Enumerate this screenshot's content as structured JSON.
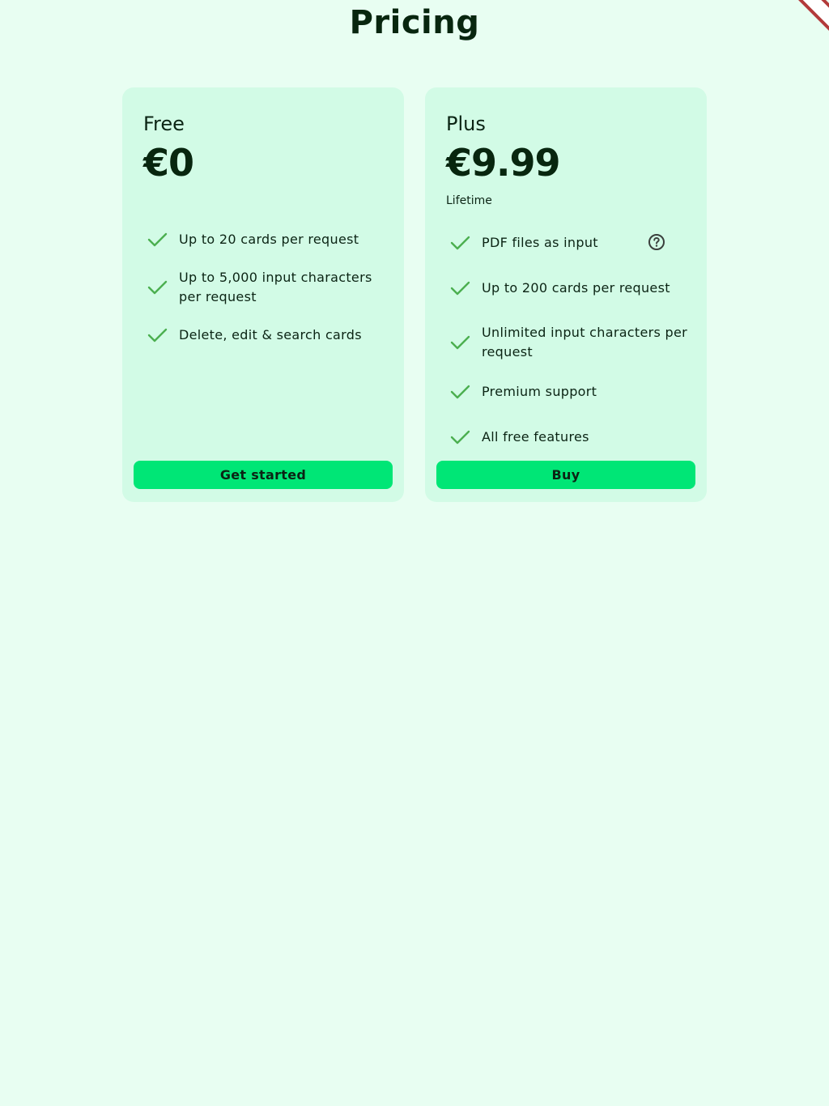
{
  "page": {
    "title": "Pricing"
  },
  "colors": {
    "background": "#e8fef2",
    "card": "#d2fbe6",
    "accent": "#00e676",
    "check": "#4caf50",
    "ribbon": "#b23a3a"
  },
  "plans": [
    {
      "name": "Free",
      "price": "€0",
      "period": "",
      "features": [
        "Up to 20 cards per request",
        "Up to 5,000 input characters per request",
        "Delete, edit & search cards"
      ],
      "cta_label": "Get started"
    },
    {
      "name": "Plus",
      "price": "€9.99",
      "period": "Lifetime",
      "features": [
        "PDF files as input",
        "Up to 200 cards per request",
        "Unlimited input characters per request",
        "Premium support",
        "All free features"
      ],
      "cta_label": "Buy"
    }
  ],
  "icons": {
    "feature_check": "check-icon",
    "feature_help": "help-circle-icon",
    "corner": "corner-ribbon"
  }
}
